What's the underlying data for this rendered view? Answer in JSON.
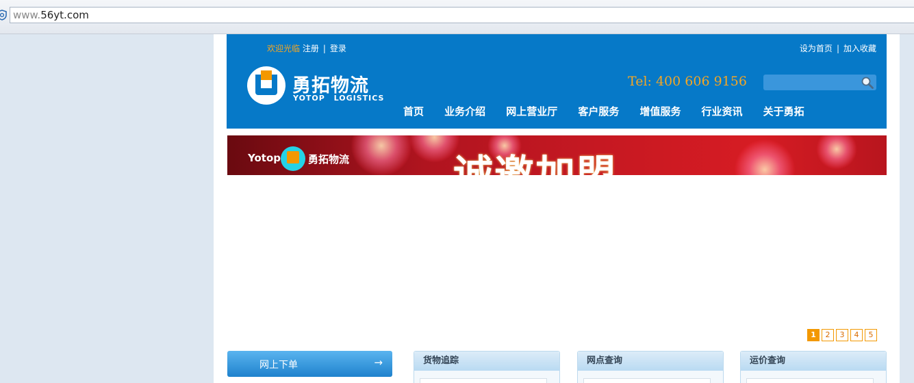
{
  "browser": {
    "url_prefix": "www.",
    "url_rest": "56yt.com"
  },
  "header": {
    "welcome": "欢迎光临",
    "register": "注册",
    "login": "登录",
    "set_home": "设为首页",
    "add_favorite": "加入收藏",
    "logo_cn": "勇拓物流",
    "logo_en": "YOTOP LOGISTICS",
    "tel": "Tel: 400 606 9156",
    "search_placeholder": ""
  },
  "nav": {
    "items": [
      {
        "label": "首页"
      },
      {
        "label": "业务介绍"
      },
      {
        "label": "网上营业厅"
      },
      {
        "label": "客户服务"
      },
      {
        "label": "增值服务"
      },
      {
        "label": "行业资讯"
      },
      {
        "label": "关于勇拓"
      }
    ]
  },
  "banner": {
    "brand_en": "Yotop",
    "brand_cn": "勇拓物流",
    "headline": "诚邀加盟"
  },
  "pager": {
    "pages": [
      "1",
      "2",
      "3",
      "4",
      "5"
    ],
    "active": "1"
  },
  "panels": {
    "order": "网上下单",
    "order_arrow": "→",
    "tracking": "货物追踪",
    "outlets": "网点查询",
    "freight": "运价查询"
  },
  "colors": {
    "header_blue": "#0679c8",
    "accent_orange": "#f39800",
    "banner_red": "#c51822"
  }
}
